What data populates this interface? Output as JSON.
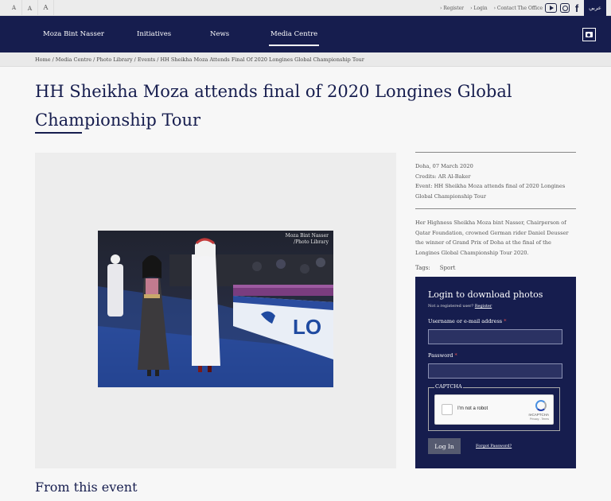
{
  "topbar": {
    "font_sizes": [
      "A",
      "A",
      "A"
    ],
    "links": [
      {
        "label": "Register"
      },
      {
        "label": "Login"
      },
      {
        "label": "Contact The Office"
      }
    ],
    "social_icons": [
      "youtube-icon",
      "instagram-icon",
      "facebook-icon"
    ],
    "language_label": "عربي"
  },
  "nav": {
    "items": [
      {
        "label": "Moza Bint Nasser"
      },
      {
        "label": "Initiatives"
      },
      {
        "label": "News"
      },
      {
        "label": "Media Centre",
        "active": true
      }
    ],
    "camera_icon": "camera-icon"
  },
  "breadcrumb": [
    "Home",
    "Media Centre",
    "Photo Library",
    "Events",
    "HH Sheikha Moza Attends Final Of 2020 Longines Global Championship Tour"
  ],
  "page_title": "HH Sheikha Moza attends final of 2020 Longines Global Championship Tour",
  "photo": {
    "watermark_line1": "Moza Bint Nasser",
    "watermark_line2": "/Photo Library"
  },
  "meta": {
    "location_date": "Doha, 07 March 2020",
    "credits": "Credits: AR Al-Baker",
    "event": "Event: HH Sheikha Moza attends final of 2020 Longines Global Championship Tour"
  },
  "description": "Her Highness Sheikha Moza bint Nasser, Chairperson of Qatar Foundation, crowned German rider Daniel Deusser the winner of Grand Prix of Doha at the final of the Longines Global Championship Tour 2020.",
  "tags": {
    "label": "Tags:",
    "items": [
      "Sport"
    ]
  },
  "login": {
    "heading": "Login to download photos",
    "not_registered": "Not a registered user?",
    "register_link": "Register",
    "username_label": "Username or e-mail address",
    "password_label": "Password",
    "required_mark": "*",
    "captcha_legend": "CAPTCHA",
    "recaptcha_label": "I'm not a robot",
    "recaptcha_brand": "reCAPTCHA",
    "recaptcha_terms": "Privacy - Terms",
    "submit_label": "Log In",
    "forgot_link": "Forgot Password?"
  },
  "section_heading": "From this event",
  "colors": {
    "navy": "#161d4e",
    "login_bg": "#161d4e",
    "input_bg": "#2b3263",
    "button_bg": "#555a70"
  }
}
